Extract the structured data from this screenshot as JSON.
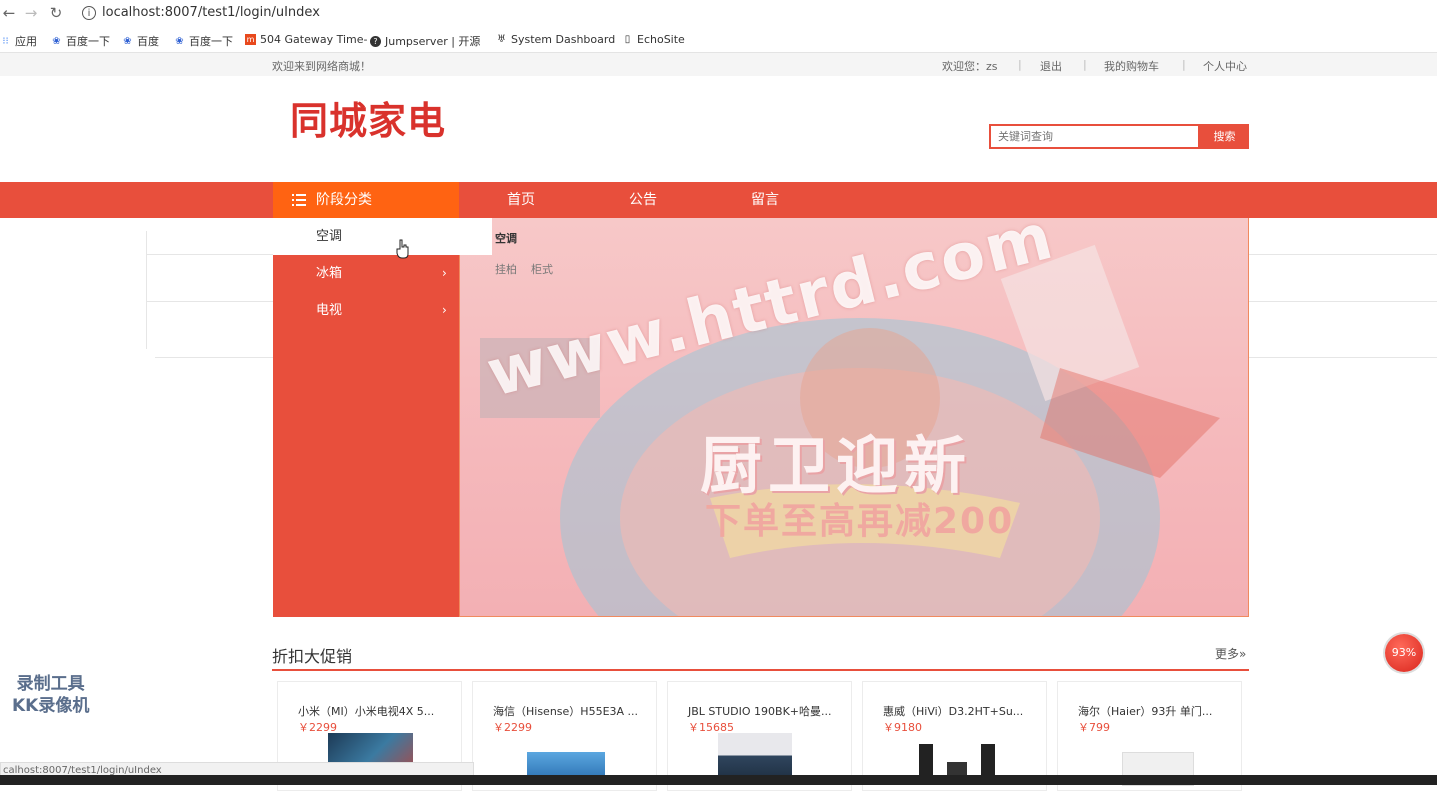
{
  "browser": {
    "url": "localhost:8007/test1/login/uIndex",
    "bookmarks": [
      "应用",
      "百度一下",
      "百度",
      "百度一下",
      "504 Gateway Time-",
      "Jumpserver | 开源",
      "System Dashboard",
      "EchoSite"
    ]
  },
  "topbar": {
    "welcome": "欢迎来到网络商城！",
    "user_greeting": "欢迎您：zs",
    "logout": "退出",
    "cart": "我的购物车",
    "profile": "个人中心",
    "separator": "|"
  },
  "header": {
    "logo": "同城家电",
    "search_placeholder": "关键词查询",
    "search_button": "搜索"
  },
  "nav": {
    "category_head": "阶段分类",
    "links": [
      "首页",
      "公告",
      "留言"
    ]
  },
  "categories": {
    "items": [
      {
        "label": "空调"
      },
      {
        "label": "冰箱",
        "chevron": "›"
      },
      {
        "label": "电视",
        "chevron": "›"
      }
    ],
    "submenu": {
      "title": "空调",
      "items": [
        "挂柏",
        "柜式"
      ]
    }
  },
  "banner": {
    "title": "厨卫迎新",
    "subtitle": "下单至高再减200",
    "watermark": "www.httrd.com"
  },
  "promo": {
    "title": "折扣大促销",
    "more": "更多»",
    "products": [
      {
        "name": "小米（MI）小米电视4X 5...",
        "price": "￥2299"
      },
      {
        "name": "海信（Hisense）H55E3A ...",
        "price": "￥2299"
      },
      {
        "name": "JBL STUDIO 190BK+哈曼...",
        "price": "￥15685"
      },
      {
        "name": "惠威（HiVi）D3.2HT+Su...",
        "price": "￥9180"
      },
      {
        "name": "海尔（Haier）93升 单门...",
        "price": "￥799"
      }
    ]
  },
  "overlay": {
    "status_url": "calhost:8007/test1/login/uIndex",
    "recorder_line1": "录制工具",
    "recorder_line2": "KK录像机",
    "speed": "93%"
  },
  "colors": {
    "brand_red": "#e84f3c",
    "accent_orange": "#ff6312",
    "logo_red": "#d9322c"
  }
}
